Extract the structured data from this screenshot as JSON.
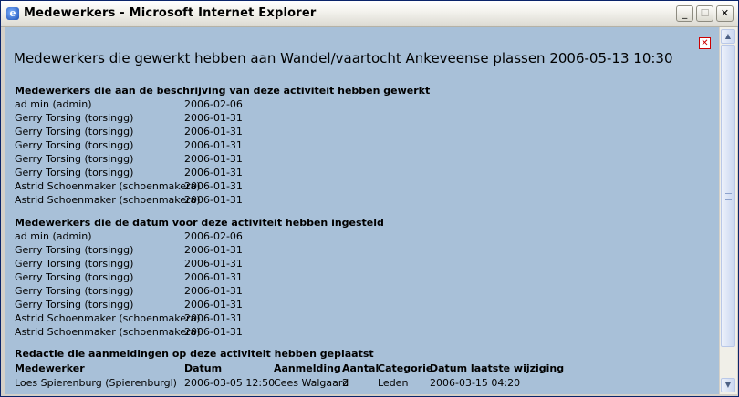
{
  "window": {
    "title": "Medewerkers - Microsoft Internet Explorer",
    "min": "_",
    "max": "☐",
    "close": "✕",
    "app_icon": "e"
  },
  "page": {
    "close_icon": "✕",
    "title": "Medewerkers die gewerkt hebben aan Wandel/vaartocht Ankeveense plassen 2006-05-13 10:30",
    "section1": {
      "heading": "Medewerkers die aan de beschrijving van deze activiteit hebben gewerkt",
      "rows": [
        {
          "name": "ad min (admin)",
          "date": "2006-02-06"
        },
        {
          "name": "Gerry Torsing (torsingg)",
          "date": "2006-01-31"
        },
        {
          "name": "Gerry Torsing (torsingg)",
          "date": "2006-01-31"
        },
        {
          "name": "Gerry Torsing (torsingg)",
          "date": "2006-01-31"
        },
        {
          "name": "Gerry Torsing (torsingg)",
          "date": "2006-01-31"
        },
        {
          "name": "Gerry Torsing (torsingg)",
          "date": "2006-01-31"
        },
        {
          "name": "Astrid Schoenmaker (schoenmakera)",
          "date": "2006-01-31"
        },
        {
          "name": "Astrid Schoenmaker (schoenmakera)",
          "date": "2006-01-31"
        }
      ]
    },
    "section2": {
      "heading": "Medewerkers die de datum voor deze activiteit hebben ingesteld",
      "rows": [
        {
          "name": "ad min (admin)",
          "date": "2006-02-06"
        },
        {
          "name": "Gerry Torsing (torsingg)",
          "date": "2006-01-31"
        },
        {
          "name": "Gerry Torsing (torsingg)",
          "date": "2006-01-31"
        },
        {
          "name": "Gerry Torsing (torsingg)",
          "date": "2006-01-31"
        },
        {
          "name": "Gerry Torsing (torsingg)",
          "date": "2006-01-31"
        },
        {
          "name": "Gerry Torsing (torsingg)",
          "date": "2006-01-31"
        },
        {
          "name": "Astrid Schoenmaker (schoenmakera)",
          "date": "2006-01-31"
        },
        {
          "name": "Astrid Schoenmaker (schoenmakera)",
          "date": "2006-01-31"
        }
      ]
    },
    "section3": {
      "heading": "Redactie die aanmeldingen op deze activiteit hebben geplaatst",
      "columns": [
        "Medewerker",
        "Datum",
        "Aanmelding",
        "Aantal",
        "Categorie",
        "Datum laatste wijziging"
      ],
      "rows": [
        {
          "medewerker": "Loes Spierenburg (Spierenburgl)",
          "datum": "2006-03-05 12:50",
          "aanmelding": "Cees Walgaard",
          "aantal": "2",
          "categorie": "Leden",
          "wijziging": "2006-03-15 04:20"
        }
      ]
    }
  },
  "scrollbar": {
    "up": "▲",
    "down": "▼"
  }
}
